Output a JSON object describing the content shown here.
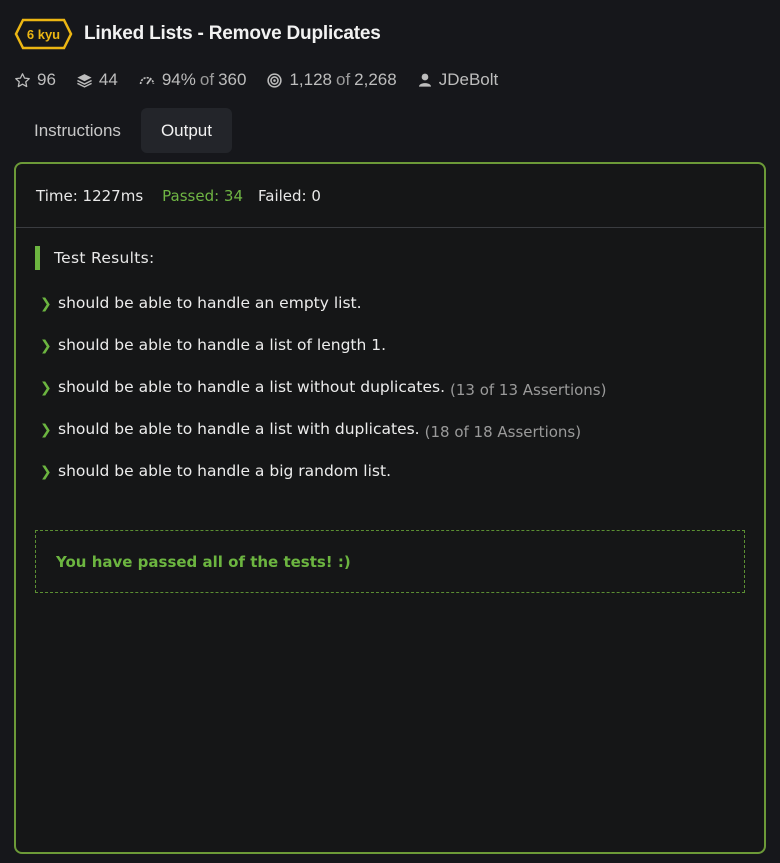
{
  "kata": {
    "rank": "6 kyu",
    "rank_color": "#ecb613",
    "title": "Linked Lists - Remove Duplicates"
  },
  "stats": {
    "stars": "96",
    "collections": "44",
    "satisfaction_pct": "94%",
    "satisfaction_of": "of",
    "satisfaction_total": "360",
    "completed": "1,128",
    "completed_of": "of",
    "completed_total": "2,268",
    "author": "JDeBolt"
  },
  "tabs": [
    {
      "label": "Instructions",
      "active": false
    },
    {
      "label": "Output",
      "active": true
    }
  ],
  "output": {
    "time": "Time: 1227ms",
    "passed": "Passed: 34",
    "failed": "Failed: 0",
    "results_title": "Test Results:",
    "tests": [
      {
        "label": "should be able to handle an empty list.",
        "assertions": ""
      },
      {
        "label": "should be able to handle a list of length 1.",
        "assertions": ""
      },
      {
        "label": "should be able to handle a list without duplicates.",
        "assertions": "(13 of 13 Assertions)"
      },
      {
        "label": "should be able to handle a list with duplicates.",
        "assertions": "(18 of 18 Assertions)"
      },
      {
        "label": "should be able to handle a big random list.",
        "assertions": ""
      }
    ],
    "success_message": "You have passed all of the tests! :)"
  },
  "colors": {
    "accent_green": "#6cb540",
    "panel_border": "#6c9a38",
    "background": "#16171b"
  },
  "icons": [
    "star-icon",
    "collection-stack-icon",
    "satisfaction-gauge-icon",
    "completed-target-icon",
    "user-icon",
    "chevron-right-icon"
  ]
}
